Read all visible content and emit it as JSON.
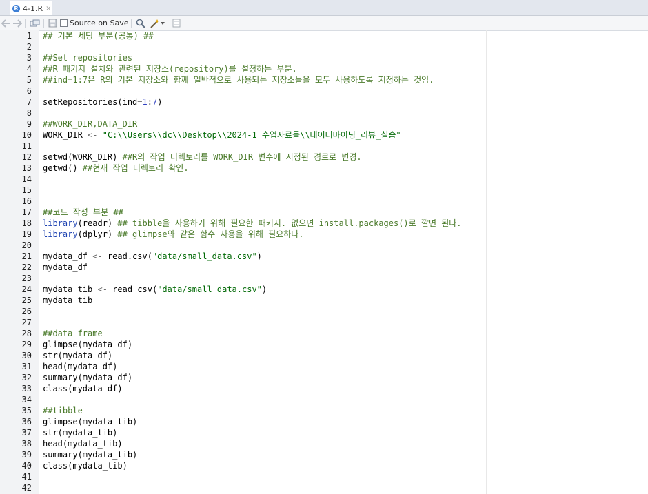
{
  "tab": {
    "label": "4-1.R",
    "close": "×",
    "icon": "r-file-icon"
  },
  "toolbar": {
    "source_on_save": "Source on Save"
  },
  "lines": [
    [
      {
        "t": "## 기본 세팅 부분(공통) ##",
        "c": "c"
      }
    ],
    [],
    [
      {
        "t": "##Set repositories",
        "c": "c"
      }
    ],
    [
      {
        "t": "##R 패키지 설치와 관련된 저장소(repository)를 설정하는 부분.",
        "c": "c"
      }
    ],
    [
      {
        "t": "##ind=1:7은 R의 기본 저장소와 함께 일반적으로 사용되는 저장소들을 모두 사용하도록 지정하는 것임.",
        "c": "c"
      }
    ],
    [],
    [
      {
        "t": "setRepositories(ind=",
        "c": ""
      },
      {
        "t": "1",
        "c": "n"
      },
      {
        "t": ":",
        "c": ""
      },
      {
        "t": "7",
        "c": "n"
      },
      {
        "t": ")",
        "c": ""
      }
    ],
    [],
    [
      {
        "t": "##WORK_DIR,DATA_DIR",
        "c": "c"
      }
    ],
    [
      {
        "t": "WORK_DIR ",
        "c": ""
      },
      {
        "t": "<-",
        "c": "o"
      },
      {
        "t": " ",
        "c": ""
      },
      {
        "t": "\"C:\\\\Users\\\\dc\\\\Desktop\\\\2024-1 수업자료들\\\\데이터마이닝_리뷰_실습\"",
        "c": "s"
      }
    ],
    [],
    [
      {
        "t": "setwd(WORK_DIR) ",
        "c": ""
      },
      {
        "t": "##R의 작업 디렉토리를 WORK_DIR 변수에 지정된 경로로 변경.",
        "c": "c"
      }
    ],
    [
      {
        "t": "getwd() ",
        "c": ""
      },
      {
        "t": "##현재 작업 디렉토리 확인.",
        "c": "c"
      }
    ],
    [],
    [],
    [],
    [
      {
        "t": "##코드 작성 부분 ##",
        "c": "c"
      }
    ],
    [
      {
        "t": "library",
        "c": "k"
      },
      {
        "t": "(readr) ",
        "c": ""
      },
      {
        "t": "## tibble을 사용하기 위해 필요한 패키지. 없으면 install.packages()로 깔면 된다.",
        "c": "c"
      }
    ],
    [
      {
        "t": "library",
        "c": "k"
      },
      {
        "t": "(dplyr) ",
        "c": ""
      },
      {
        "t": "## glimpse와 같은 함수 사용을 위해 필요하다.",
        "c": "c"
      }
    ],
    [],
    [
      {
        "t": "mydata_df ",
        "c": ""
      },
      {
        "t": "<-",
        "c": "o"
      },
      {
        "t": " read.csv(",
        "c": ""
      },
      {
        "t": "\"data/small_data.csv\"",
        "c": "s"
      },
      {
        "t": ")",
        "c": ""
      }
    ],
    [
      {
        "t": "mydata_df",
        "c": ""
      }
    ],
    [],
    [
      {
        "t": "mydata_tib ",
        "c": ""
      },
      {
        "t": "<-",
        "c": "o"
      },
      {
        "t": " read_csv(",
        "c": ""
      },
      {
        "t": "\"data/small_data.csv\"",
        "c": "s"
      },
      {
        "t": ")",
        "c": ""
      }
    ],
    [
      {
        "t": "mydata_tib",
        "c": ""
      }
    ],
    [],
    [],
    [
      {
        "t": "##data frame",
        "c": "c"
      }
    ],
    [
      {
        "t": "glimpse(mydata_df)",
        "c": ""
      }
    ],
    [
      {
        "t": "str(mydata_df)",
        "c": ""
      }
    ],
    [
      {
        "t": "head(mydata_df)",
        "c": ""
      }
    ],
    [
      {
        "t": "summary(mydata_df)",
        "c": ""
      }
    ],
    [
      {
        "t": "class(mydata_df)",
        "c": ""
      }
    ],
    [],
    [
      {
        "t": "##tibble",
        "c": "c"
      }
    ],
    [
      {
        "t": "glimpse(mydata_tib)",
        "c": ""
      }
    ],
    [
      {
        "t": "str(mydata_tib)",
        "c": ""
      }
    ],
    [
      {
        "t": "head(mydata_tib)",
        "c": ""
      }
    ],
    [
      {
        "t": "summary(mydata_tib)",
        "c": ""
      }
    ],
    [
      {
        "t": "class(mydata_tib)",
        "c": ""
      }
    ],
    [],
    []
  ]
}
